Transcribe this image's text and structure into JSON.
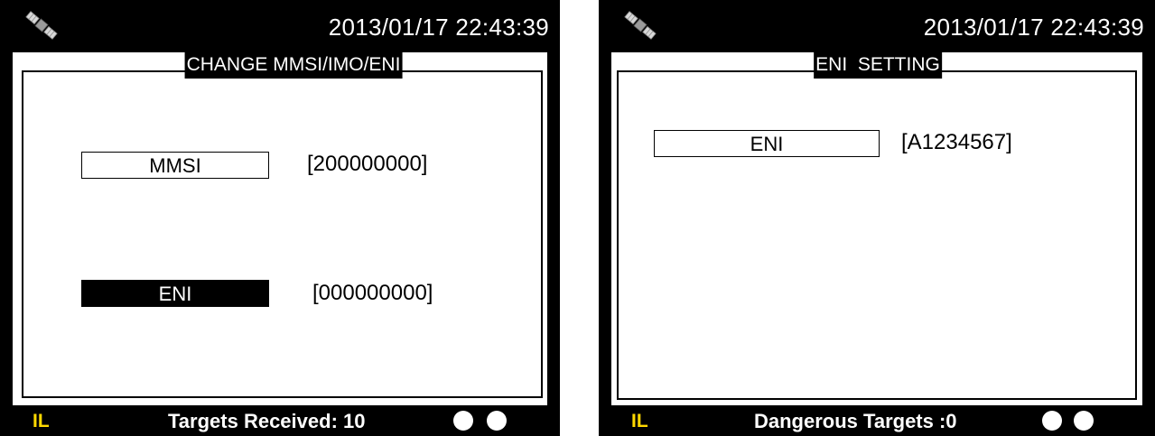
{
  "left_screen": {
    "datetime": "2013/01/17 22:43:39",
    "panel_title": "CHANGE MMSI/IMO/ENI",
    "fields": [
      {
        "label": "MMSI",
        "value": "[200000000]",
        "selected": false
      },
      {
        "label": "ENI",
        "value": "[000000000]",
        "selected": true
      }
    ],
    "status": {
      "mode": "IL",
      "text": "Targets Received: 10"
    }
  },
  "right_screen": {
    "datetime": "2013/01/17 22:43:39",
    "panel_title": "ENI  SETTING",
    "fields": [
      {
        "label": "ENI",
        "value": "[A1234567]",
        "selected": false
      }
    ],
    "status": {
      "mode": "IL",
      "text": "Dangerous Targets :0"
    }
  },
  "colors": {
    "screen_bg": "#000000",
    "panel_bg": "#ffffff",
    "mode_text": "#ffd800",
    "status_text": "#ffffff"
  },
  "icons": {
    "header": "satellite-icon",
    "status_indicators": [
      "indicator-dot-icon",
      "indicator-dot-icon"
    ]
  }
}
